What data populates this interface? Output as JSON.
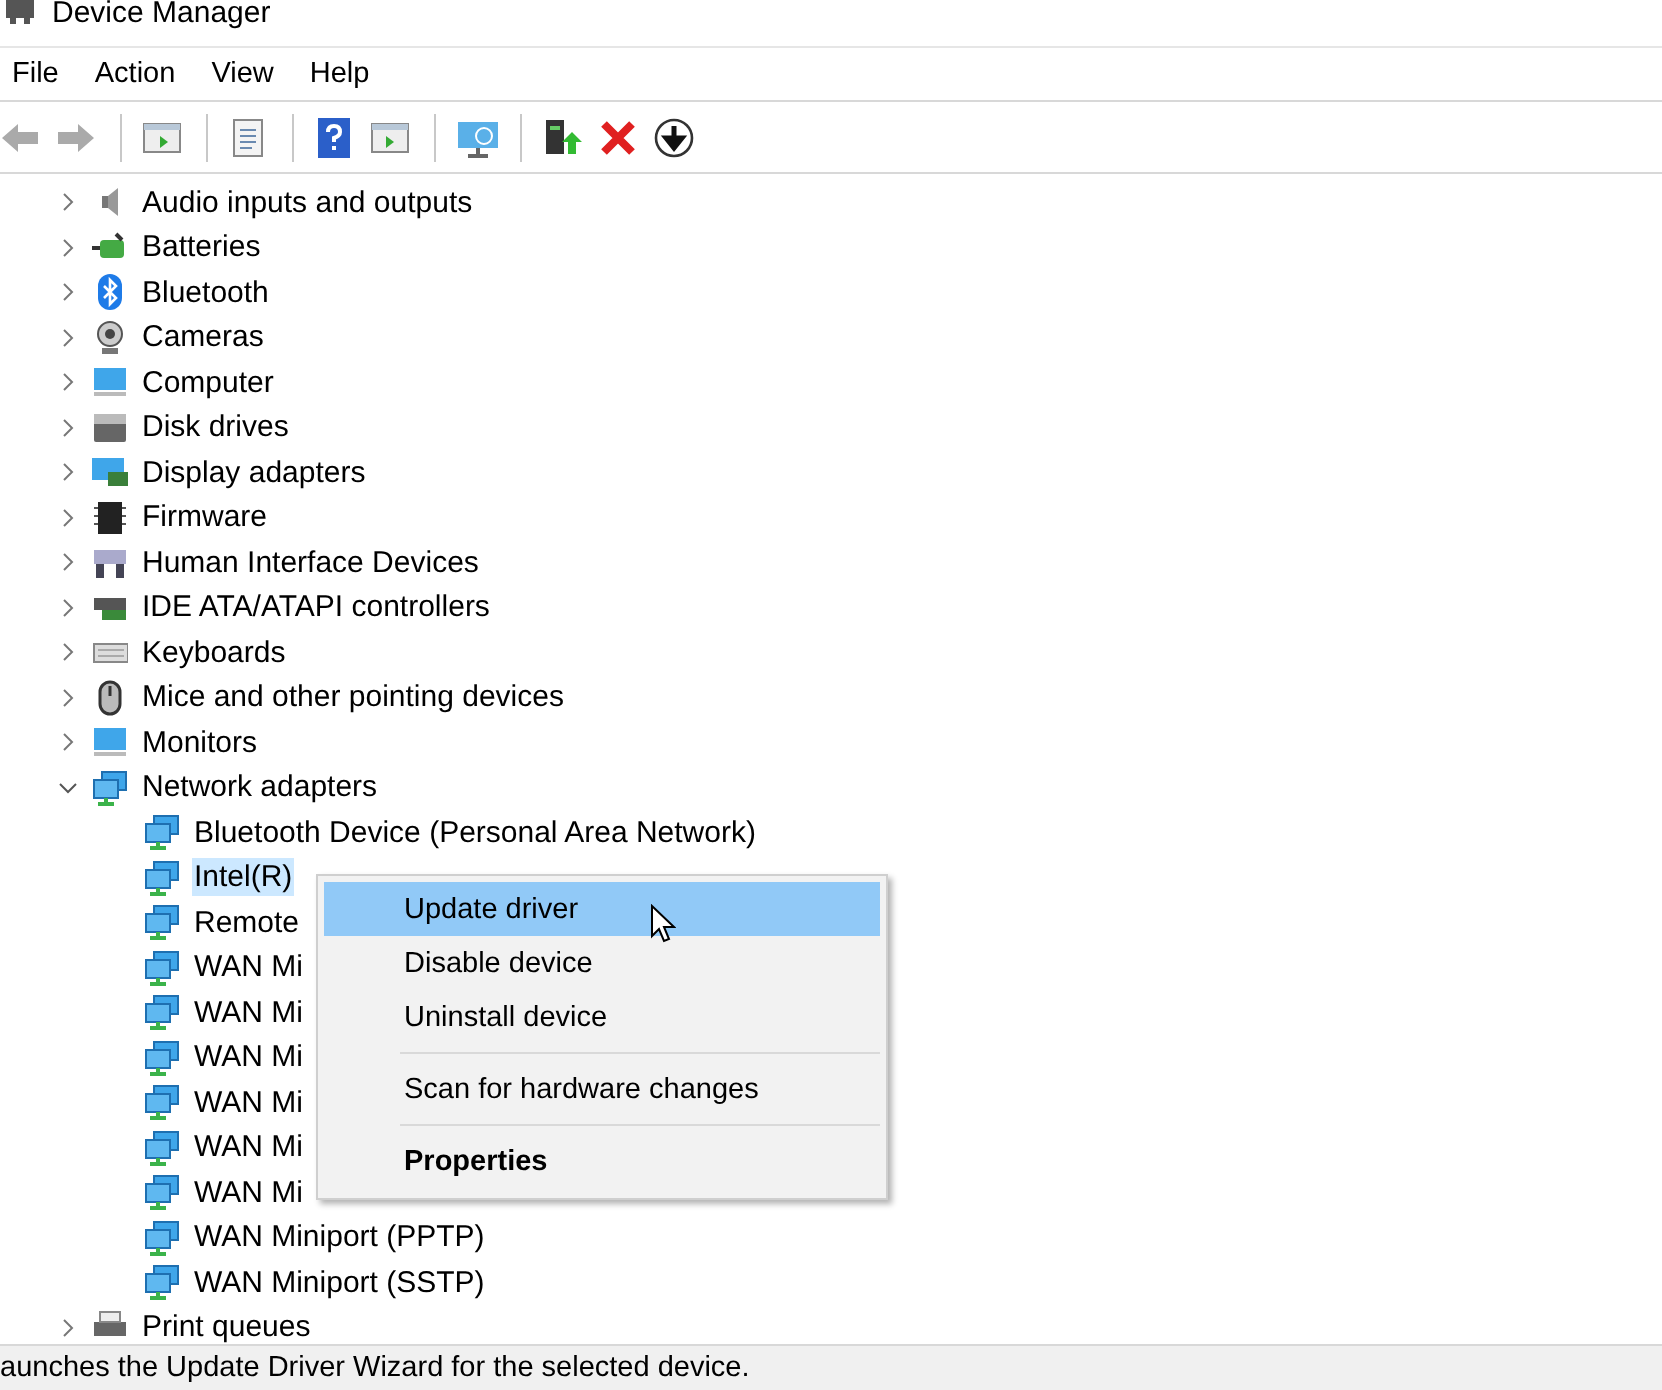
{
  "window": {
    "title": "Device Manager"
  },
  "menu_bar": [
    {
      "label": "File"
    },
    {
      "label": "Action"
    },
    {
      "label": "View"
    },
    {
      "label": "Help"
    }
  ],
  "toolbar": [
    {
      "kind": "back"
    },
    {
      "kind": "forward"
    },
    {
      "kind": "separator"
    },
    {
      "kind": "tree"
    },
    {
      "kind": "separator"
    },
    {
      "kind": "properties"
    },
    {
      "kind": "separator"
    },
    {
      "kind": "help"
    },
    {
      "kind": "pane"
    },
    {
      "kind": "separator"
    },
    {
      "kind": "scan"
    },
    {
      "kind": "separator"
    },
    {
      "kind": "update"
    },
    {
      "kind": "remove"
    },
    {
      "kind": "download"
    }
  ],
  "tree": [
    {
      "label": "Audio inputs and outputs",
      "kind": "audio",
      "expanded": false,
      "selected": false
    },
    {
      "label": "Batteries",
      "kind": "battery",
      "expanded": false,
      "selected": false
    },
    {
      "label": "Bluetooth",
      "kind": "bluetooth",
      "expanded": false,
      "selected": false
    },
    {
      "label": "Cameras",
      "kind": "camera",
      "expanded": false,
      "selected": false
    },
    {
      "label": "Computer",
      "kind": "computer",
      "expanded": false,
      "selected": false
    },
    {
      "label": "Disk drives",
      "kind": "disk",
      "expanded": false,
      "selected": false
    },
    {
      "label": "Display adapters",
      "kind": "display",
      "expanded": false,
      "selected": false
    },
    {
      "label": "Firmware",
      "kind": "chip",
      "expanded": false,
      "selected": false
    },
    {
      "label": "Human Interface Devices",
      "kind": "hid",
      "expanded": false,
      "selected": false
    },
    {
      "label": "IDE ATA/ATAPI controllers",
      "kind": "ide",
      "expanded": false,
      "selected": false
    },
    {
      "label": "Keyboards",
      "kind": "keyboard",
      "expanded": false,
      "selected": false
    },
    {
      "label": "Mice and other pointing devices",
      "kind": "mouse",
      "expanded": false,
      "selected": false
    },
    {
      "label": "Monitors",
      "kind": "computer",
      "expanded": false,
      "selected": false
    },
    {
      "label": "Network adapters",
      "kind": "network",
      "expanded": true,
      "selected": false,
      "children": [
        {
          "label": "Bluetooth Device (Personal Area Network)",
          "kind": "network",
          "selected": false
        },
        {
          "label": "Intel(R)",
          "kind": "network",
          "selected": true
        },
        {
          "label": "Remote",
          "kind": "network",
          "selected": false
        },
        {
          "label": "WAN Mi",
          "kind": "network",
          "selected": false
        },
        {
          "label": "WAN Mi",
          "kind": "network",
          "selected": false
        },
        {
          "label": "WAN Mi",
          "kind": "network",
          "selected": false
        },
        {
          "label": "WAN Mi",
          "kind": "network",
          "selected": false
        },
        {
          "label": "WAN Mi",
          "kind": "network",
          "selected": false
        },
        {
          "label": "WAN Mi",
          "kind": "network",
          "selected": false
        },
        {
          "label": "WAN Miniport (PPTP)",
          "kind": "network",
          "selected": false
        },
        {
          "label": "WAN Miniport (SSTP)",
          "kind": "network",
          "selected": false
        }
      ]
    },
    {
      "label": "Print queues",
      "kind": "printer",
      "expanded": false,
      "selected": false
    }
  ],
  "context_menu": [
    {
      "kind": "item",
      "label": "Update driver",
      "selected": true
    },
    {
      "kind": "item",
      "label": "Disable device",
      "selected": false
    },
    {
      "kind": "item",
      "label": "Uninstall device",
      "selected": false
    },
    {
      "kind": "separator"
    },
    {
      "kind": "item",
      "label": "Scan for hardware changes",
      "selected": false
    },
    {
      "kind": "separator"
    },
    {
      "kind": "default",
      "label": "Properties",
      "selected": false
    }
  ],
  "status_bar": {
    "text": "aunches the Update Driver Wizard for the selected device."
  }
}
